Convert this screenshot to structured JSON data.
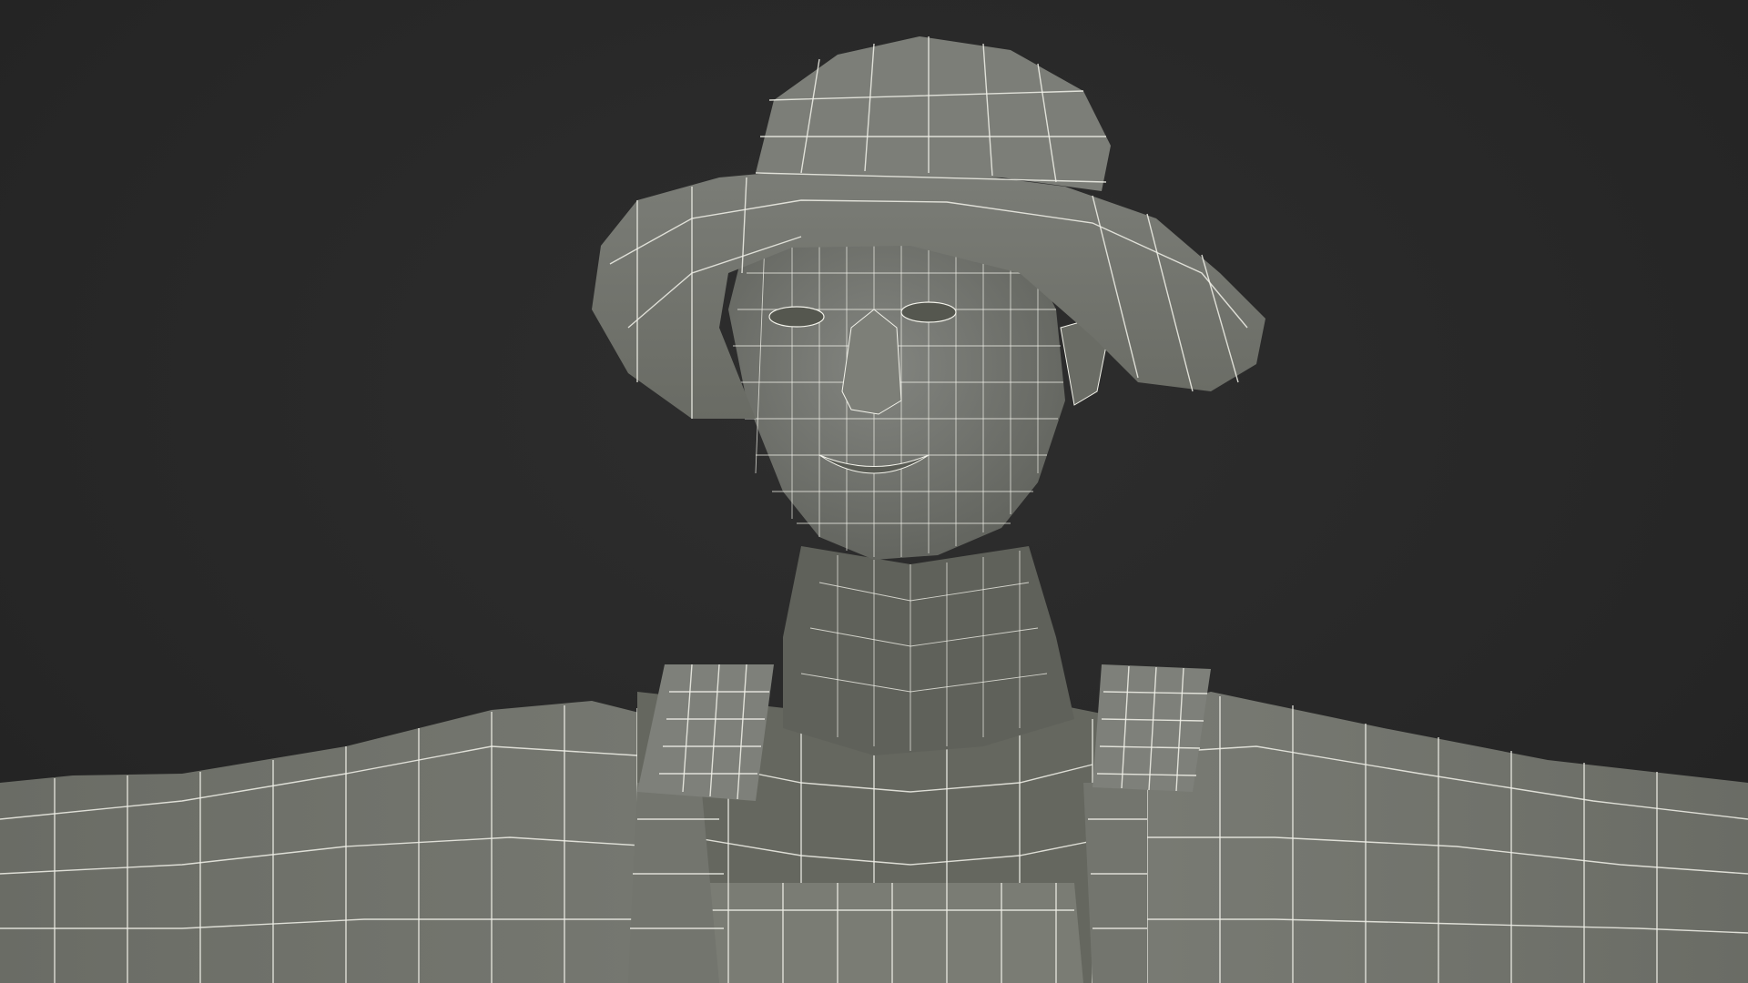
{
  "scene": {
    "background_color": "#292929",
    "mesh_fill_color": "#6f716a",
    "mesh_shadow_color": "#54564f",
    "mesh_highlight_color": "#858780",
    "wire_color": "#f2f2ea",
    "subject": "wireframe-character-bust"
  }
}
